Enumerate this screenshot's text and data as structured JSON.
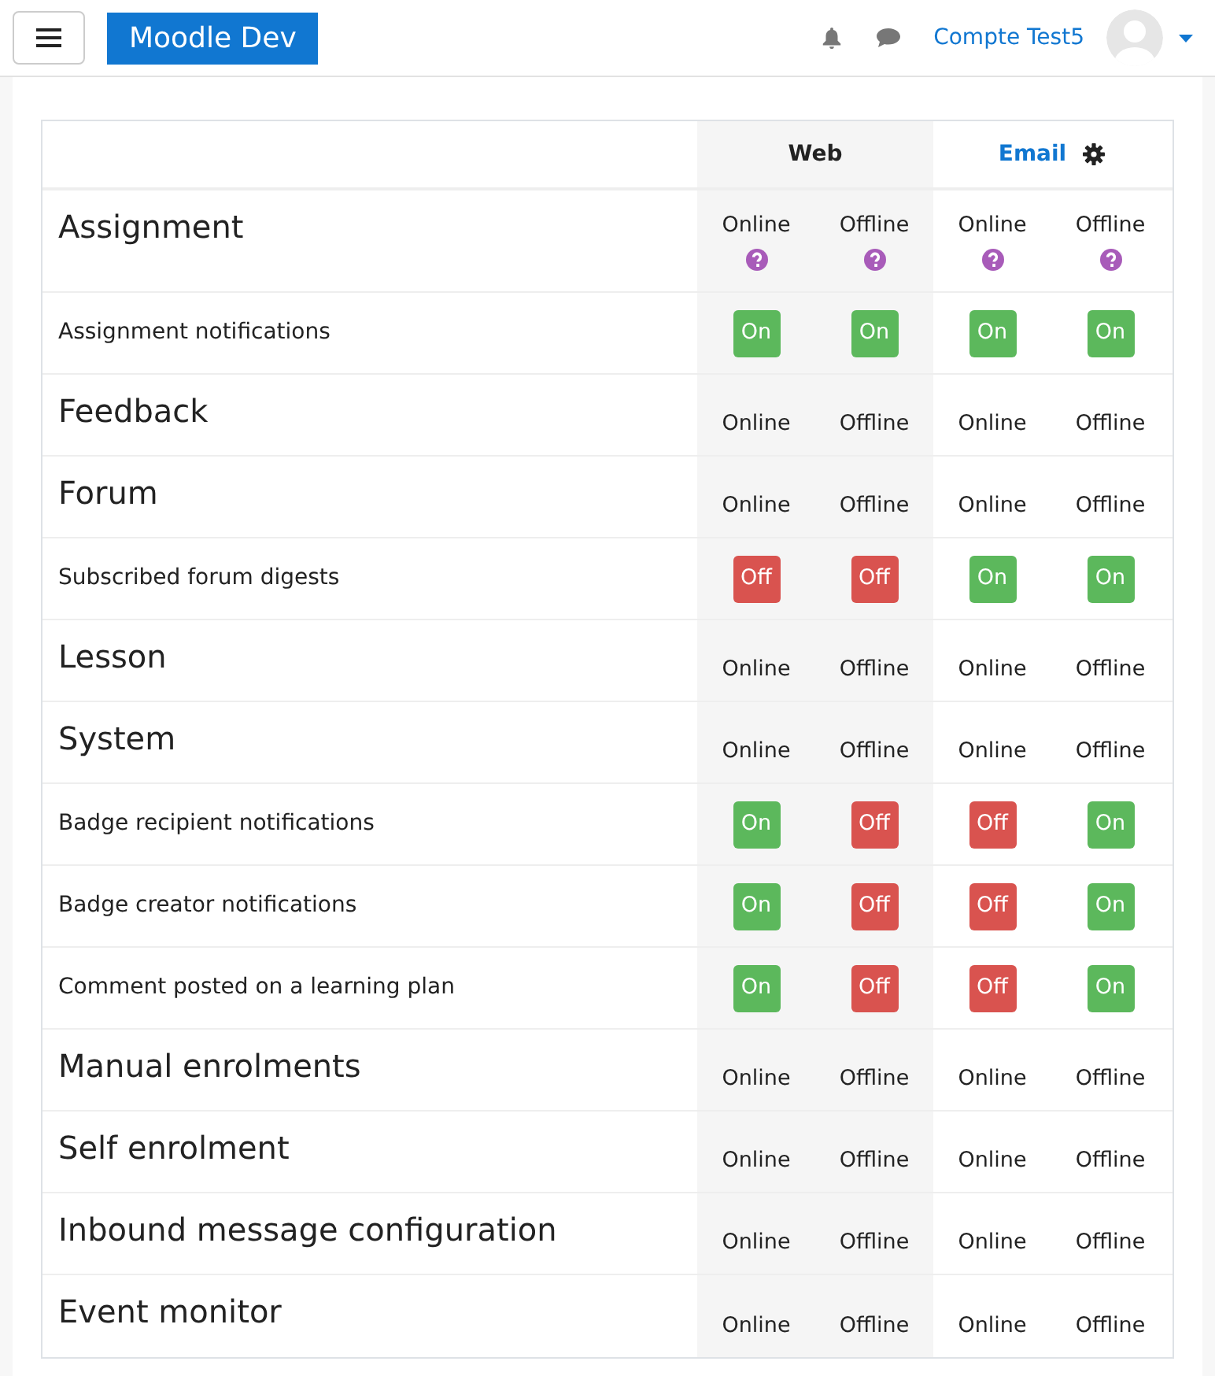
{
  "navbar": {
    "brand": "Moodle Dev",
    "user_name": "Compte Test5"
  },
  "table": {
    "columns": [
      {
        "label": "Web",
        "kind": "plain"
      },
      {
        "label": "Email",
        "kind": "link"
      }
    ],
    "rows": [
      {
        "kind": "component",
        "name": "Assignment",
        "states": [
          "Online",
          "Offline",
          "Online",
          "Offline"
        ],
        "help": true
      },
      {
        "kind": "notification",
        "name": "Assignment notifications",
        "toggles": [
          {
            "label": "On",
            "on": true
          },
          {
            "label": "On",
            "on": true
          },
          {
            "label": "On",
            "on": true
          },
          {
            "label": "On",
            "on": true
          }
        ]
      },
      {
        "kind": "component",
        "name": "Feedback",
        "states": [
          "Online",
          "Offline",
          "Online",
          "Offline"
        ],
        "help": false
      },
      {
        "kind": "component",
        "name": "Forum",
        "states": [
          "Online",
          "Offline",
          "Online",
          "Offline"
        ],
        "help": false
      },
      {
        "kind": "notification",
        "name": "Subscribed forum digests",
        "toggles": [
          {
            "label": "Off",
            "on": false
          },
          {
            "label": "Off",
            "on": false
          },
          {
            "label": "On",
            "on": true
          },
          {
            "label": "On",
            "on": true
          }
        ]
      },
      {
        "kind": "component",
        "name": "Lesson",
        "states": [
          "Online",
          "Offline",
          "Online",
          "Offline"
        ],
        "help": false
      },
      {
        "kind": "component",
        "name": "System",
        "states": [
          "Online",
          "Offline",
          "Online",
          "Offline"
        ],
        "help": false
      },
      {
        "kind": "notification",
        "name": "Badge recipient notifications",
        "toggles": [
          {
            "label": "On",
            "on": true
          },
          {
            "label": "Off",
            "on": false
          },
          {
            "label": "Off",
            "on": false
          },
          {
            "label": "On",
            "on": true
          }
        ]
      },
      {
        "kind": "notification",
        "name": "Badge creator notifications",
        "toggles": [
          {
            "label": "On",
            "on": true
          },
          {
            "label": "Off",
            "on": false
          },
          {
            "label": "Off",
            "on": false
          },
          {
            "label": "On",
            "on": true
          }
        ]
      },
      {
        "kind": "notification",
        "name": "Comment posted on a learning plan",
        "toggles": [
          {
            "label": "On",
            "on": true
          },
          {
            "label": "Off",
            "on": false
          },
          {
            "label": "Off",
            "on": false
          },
          {
            "label": "On",
            "on": true
          }
        ]
      },
      {
        "kind": "component",
        "name": "Manual enrolments",
        "states": [
          "Online",
          "Offline",
          "Online",
          "Offline"
        ],
        "help": false
      },
      {
        "kind": "component",
        "name": "Self enrolment",
        "states": [
          "Online",
          "Offline",
          "Online",
          "Offline"
        ],
        "help": false
      },
      {
        "kind": "component",
        "name": "Inbound message configuration",
        "states": [
          "Online",
          "Offline",
          "Online",
          "Offline"
        ],
        "help": false
      },
      {
        "kind": "component",
        "name": "Event monitor",
        "states": [
          "Online",
          "Offline",
          "Online",
          "Offline"
        ],
        "help": false
      }
    ]
  }
}
